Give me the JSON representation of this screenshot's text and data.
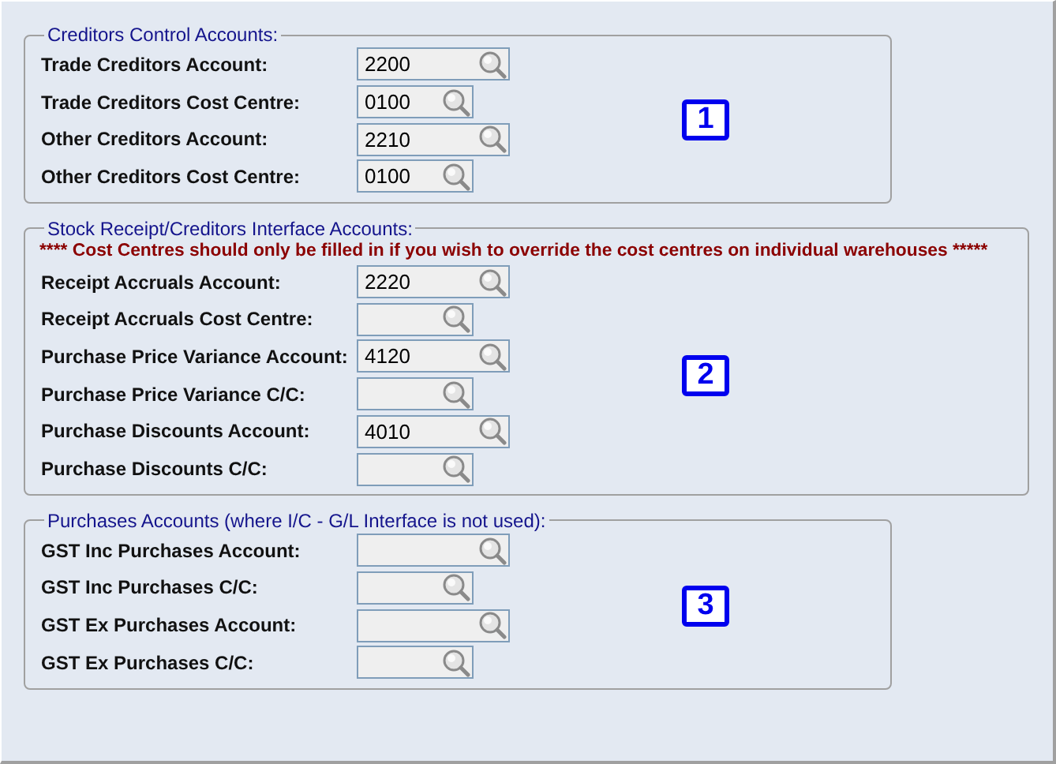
{
  "groups": [
    {
      "title": "Creditors Control Accounts:",
      "badge": "1",
      "fields": [
        {
          "label": "Trade Creditors Account:",
          "value": "2200",
          "kind": "wide"
        },
        {
          "label": "Trade Creditors Cost Centre:",
          "value": "0100",
          "kind": "narrow"
        },
        {
          "label": "Other Creditors Account:",
          "value": "2210",
          "kind": "wide"
        },
        {
          "label": "Other Creditors Cost Centre:",
          "value": "0100",
          "kind": "narrow"
        }
      ]
    },
    {
      "title": "Stock Receipt/Creditors Interface Accounts:",
      "warning": "**** Cost Centres should only be filled in if you wish to override the cost centres on individual warehouses *****",
      "badge": "2",
      "fields": [
        {
          "label": "Receipt Accruals Account:",
          "value": "2220",
          "kind": "wide"
        },
        {
          "label": "Receipt Accruals Cost Centre:",
          "kind": "narrow"
        },
        {
          "label": "Purchase Price Variance Account:",
          "value": "4120",
          "kind": "wide"
        },
        {
          "label": "Purchase Price Variance C/C:",
          "kind": "narrow"
        },
        {
          "label": "Purchase Discounts Account:",
          "value": "4010",
          "kind": "wide"
        },
        {
          "label": "Purchase Discounts C/C:",
          "kind": "narrow"
        }
      ]
    },
    {
      "title": "Purchases Accounts (where I/C - G/L Interface is not used):",
      "badge": "3",
      "fields": [
        {
          "label": "GST Inc Purchases Account:",
          "kind": "wide"
        },
        {
          "label": "GST Inc Purchases C/C:",
          "kind": "narrow"
        },
        {
          "label": "GST Ex Purchases Account:",
          "kind": "wide"
        },
        {
          "label": "GST Ex Purchases C/C:",
          "kind": "narrow"
        }
      ]
    }
  ]
}
